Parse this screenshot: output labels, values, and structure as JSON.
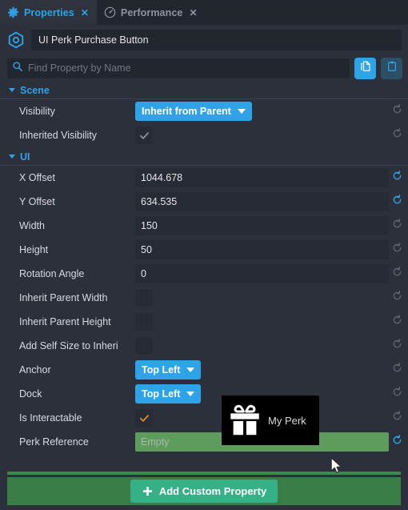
{
  "tabs": [
    {
      "label": "Properties",
      "icon": "gear-icon",
      "active": true,
      "close": "✕"
    },
    {
      "label": "Performance",
      "icon": "gauge-icon",
      "active": false,
      "close": "✕"
    }
  ],
  "header": {
    "object_icon": "entity-hexagon-icon",
    "object_name": "UI Perk Purchase Button"
  },
  "search": {
    "placeholder": "Find Property by Name",
    "value": "",
    "icon": "search-icon",
    "copy_button": "copy-icon",
    "paste_button": "paste-icon"
  },
  "sections": [
    {
      "title": "Scene",
      "expanded": true,
      "rows": [
        {
          "label": "Visibility",
          "type": "dropdown",
          "value": "Inherit from Parent",
          "reset": "inactive"
        },
        {
          "label": "Inherited Visibility",
          "type": "checkbox",
          "checked": true,
          "check_color": "#8a9099",
          "reset": "inactive"
        }
      ]
    },
    {
      "title": "UI",
      "expanded": true,
      "rows": [
        {
          "label": "X Offset",
          "type": "text",
          "value": "1044.678",
          "reset": "active"
        },
        {
          "label": "Y Offset",
          "type": "text",
          "value": "634.535",
          "reset": "active"
        },
        {
          "label": "Width",
          "type": "text",
          "value": "150",
          "reset": "inactive"
        },
        {
          "label": "Height",
          "type": "text",
          "value": "50",
          "reset": "inactive"
        },
        {
          "label": "Rotation Angle",
          "type": "text",
          "value": "0",
          "reset": "inactive"
        },
        {
          "label": "Inherit Parent Width",
          "type": "checkbox",
          "checked": false,
          "reset": "inactive"
        },
        {
          "label": "Inherit Parent Height",
          "type": "checkbox",
          "checked": false,
          "reset": "inactive"
        },
        {
          "label": "Add Self Size to Inheri",
          "type": "checkbox",
          "checked": false,
          "reset": "inactive"
        },
        {
          "label": "Anchor",
          "type": "dropdown",
          "value": "Top Left",
          "reset": "inactive"
        },
        {
          "label": "Dock",
          "type": "dropdown",
          "value": "Top Left",
          "reset": "inactive"
        },
        {
          "label": "Is Interactable",
          "type": "checkbox",
          "checked": true,
          "check_color": "#e08a2b",
          "reset": "inactive"
        },
        {
          "label": "Perk Reference",
          "type": "text-green",
          "value": "Empty",
          "reset": "active"
        }
      ]
    }
  ],
  "drag_tooltip": {
    "icon": "gift-icon",
    "label": "My Perk"
  },
  "footer": {
    "add_label": "Add Custom Property",
    "add_icon": "plus-icon"
  },
  "colors": {
    "accent_blue": "#2ea3e8",
    "panel_bg": "#2b303b",
    "tabbar_bg": "#22262f",
    "field_bg": "#262b35",
    "green_field": "#5d9c5c",
    "dropzone_green": "#3a7d46",
    "add_button_green": "#35b087",
    "check_orange": "#e08a2b"
  }
}
